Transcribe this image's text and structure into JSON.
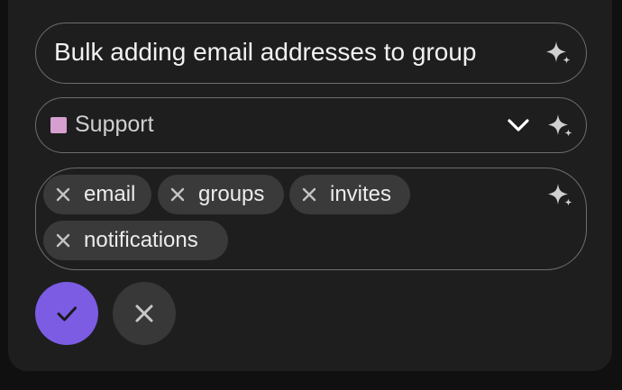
{
  "form": {
    "title_value": "Bulk adding email addresses to group",
    "category": {
      "label": "Support",
      "color": "#d79fd0"
    },
    "tags": [
      {
        "label": "email"
      },
      {
        "label": "groups"
      },
      {
        "label": "invites"
      },
      {
        "label": "notifications"
      }
    ],
    "icons": {
      "ai_suggest": "sparkle-icon",
      "dropdown": "chevron-down-icon",
      "remove_tag": "close-icon",
      "confirm": "check-icon",
      "cancel": "close-icon"
    }
  },
  "theme": {
    "accent": "#7b5ce3",
    "panel_background": "#1e1e1e",
    "border": "#6e6e6e",
    "tag_background": "#3a3a3a"
  }
}
